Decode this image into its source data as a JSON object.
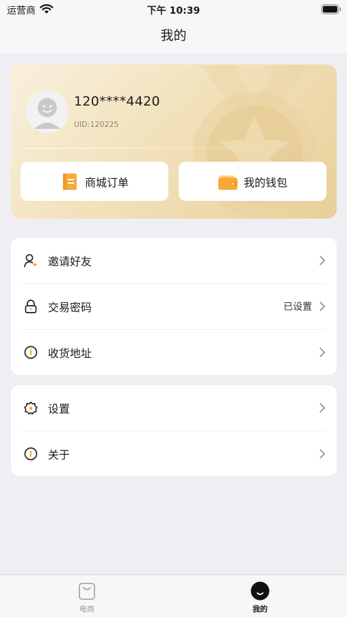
{
  "status_bar": {
    "carrier": "运营商",
    "time": "下午 10:39"
  },
  "nav": {
    "title": "我的"
  },
  "profile": {
    "phone": "120****4420",
    "uid": "UID:120225",
    "orders_label": "商城订单",
    "wallet_label": "我的钱包"
  },
  "menu_group_1": [
    {
      "label": "邀请好友",
      "value": "",
      "icon": "invite-user-icon"
    },
    {
      "label": "交易密码",
      "value": "已设置",
      "icon": "lock-icon"
    },
    {
      "label": "收货地址",
      "value": "",
      "icon": "address-info-icon"
    }
  ],
  "menu_group_2": [
    {
      "label": "设置",
      "value": "",
      "icon": "settings-flower-icon"
    },
    {
      "label": "关于",
      "value": "",
      "icon": "about-info-icon"
    }
  ],
  "tab_bar": {
    "tabs": [
      {
        "label": "电商",
        "icon": "shopping-bag-icon",
        "active": false
      },
      {
        "label": "我的",
        "icon": "smile-face-icon",
        "active": true
      }
    ]
  },
  "colors": {
    "card_gradient_start": "#f9f0dd",
    "card_gradient_end": "#e8cf98",
    "accent_orange": "#f5a623",
    "page_background": "#efeff3"
  }
}
